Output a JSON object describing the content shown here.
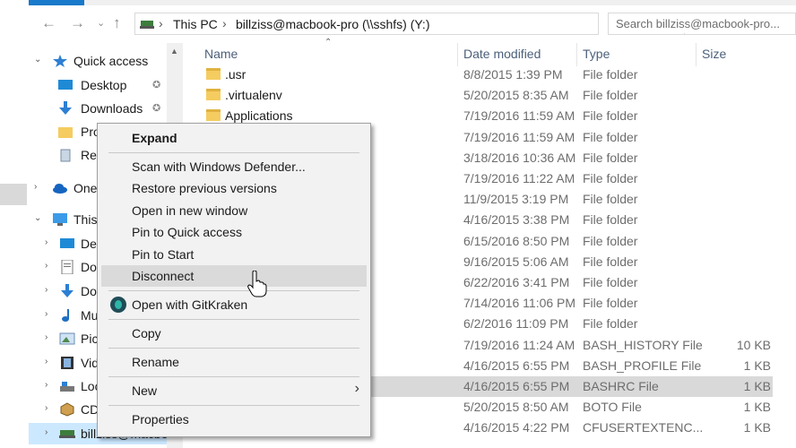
{
  "address_bar": {
    "crumbs": [
      "This PC",
      "billziss@macbook-pro (\\\\sshfs) (Y:)"
    ],
    "search_placeholder": "Search billziss@macbook-pro..."
  },
  "nav_pane": {
    "quick_access": "Quick access",
    "items": [
      {
        "label": "Desktop"
      },
      {
        "label": "Downloads"
      },
      {
        "label": "Pro"
      },
      {
        "label": "Rec"
      },
      {
        "label": "OneD"
      },
      {
        "label": "This"
      },
      {
        "label": "Des"
      },
      {
        "label": "Doc"
      },
      {
        "label": "Dow"
      },
      {
        "label": "Mus"
      },
      {
        "label": "Pict"
      },
      {
        "label": "Vid"
      },
      {
        "label": "Loc"
      },
      {
        "label": "CD"
      },
      {
        "label": "billziss@macbo"
      }
    ]
  },
  "columns": {
    "name": "Name",
    "date": "Date modified",
    "type": "Type",
    "size": "Size"
  },
  "files": [
    {
      "name": ".usr",
      "date": "8/8/2015 1:39 PM",
      "type": "File folder",
      "size": ""
    },
    {
      "name": ".virtualenv",
      "date": "5/20/2015 8:35 AM",
      "type": "File folder",
      "size": ""
    },
    {
      "name": "Applications",
      "date": "7/19/2016 11:59 AM",
      "type": "File folder",
      "size": ""
    },
    {
      "name": "",
      "date": "7/19/2016 11:59 AM",
      "type": "File folder",
      "size": ""
    },
    {
      "name": "",
      "date": "3/18/2016 10:36 AM",
      "type": "File folder",
      "size": ""
    },
    {
      "name": "",
      "date": "7/19/2016 11:22 AM",
      "type": "File folder",
      "size": ""
    },
    {
      "name": "",
      "date": "11/9/2015 3:19 PM",
      "type": "File folder",
      "size": ""
    },
    {
      "name": "",
      "date": "4/16/2015 3:38 PM",
      "type": "File folder",
      "size": ""
    },
    {
      "name": "",
      "date": "6/15/2016 8:50 PM",
      "type": "File folder",
      "size": ""
    },
    {
      "name": "",
      "date": "9/16/2015 5:06 AM",
      "type": "File folder",
      "size": ""
    },
    {
      "name": "",
      "date": "6/22/2016 3:41 PM",
      "type": "File folder",
      "size": ""
    },
    {
      "name": "",
      "date": "7/14/2016 11:06 PM",
      "type": "File folder",
      "size": ""
    },
    {
      "name": "",
      "date": "6/2/2016 11:09 PM",
      "type": "File folder",
      "size": ""
    },
    {
      "name": "",
      "date": "7/19/2016 11:24 AM",
      "type": "BASH_HISTORY File",
      "size": "10 KB"
    },
    {
      "name": "",
      "date": "4/16/2015 6:55 PM",
      "type": "BASH_PROFILE File",
      "size": "1 KB"
    },
    {
      "name": "",
      "date": "4/16/2015 6:55 PM",
      "type": "BASHRC File",
      "size": "1 KB"
    },
    {
      "name": "",
      "date": "5/20/2015 8:50 AM",
      "type": "BOTO File",
      "size": "1 KB"
    },
    {
      "name": "",
      "date": "4/16/2015 4:22 PM",
      "type": "CFUSERTEXTENC...",
      "size": "1 KB"
    }
  ],
  "context_menu": {
    "expand": "Expand",
    "scan": "Scan with Windows Defender...",
    "restore": "Restore previous versions",
    "open_new": "Open in new window",
    "pin_quick": "Pin to Quick access",
    "pin_start": "Pin to Start",
    "disconnect": "Disconnect",
    "gitkraken": "Open with GitKraken",
    "copy": "Copy",
    "rename": "Rename",
    "new": "New",
    "properties": "Properties"
  }
}
